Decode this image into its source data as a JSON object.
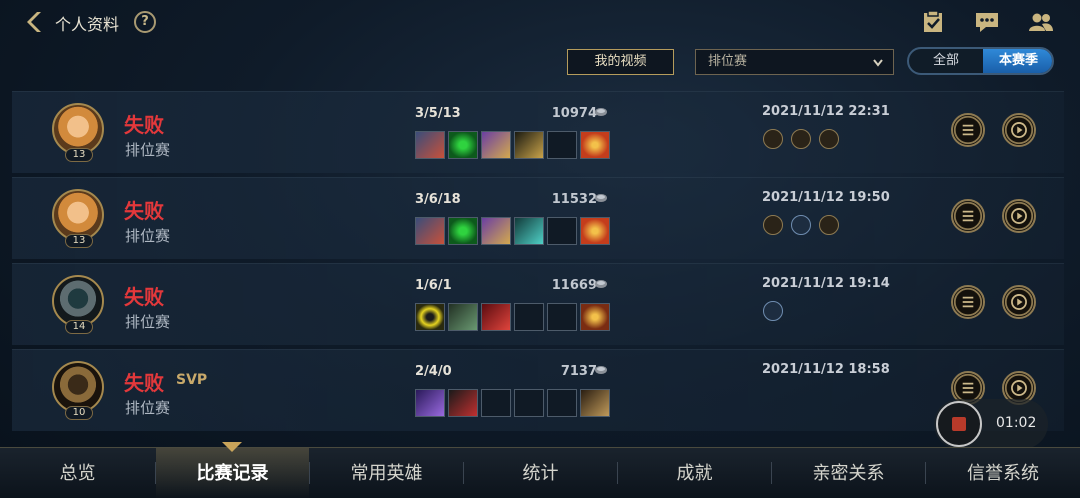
{
  "header": {
    "title": "个人资料",
    "help": "?"
  },
  "toolbar": {
    "video_button": "我的视频",
    "mode_select": "排位赛",
    "toggle_all": "全部",
    "toggle_season": "本赛季"
  },
  "matches": [
    {
      "level": "13",
      "result": "失败",
      "svp": "",
      "mode": "排位赛",
      "kda": "3/5/13",
      "gold": "10974",
      "time": "2021/11/12 22:31"
    },
    {
      "level": "13",
      "result": "失败",
      "svp": "",
      "mode": "排位赛",
      "kda": "3/6/18",
      "gold": "11532",
      "time": "2021/11/12 19:50"
    },
    {
      "level": "14",
      "result": "失败",
      "svp": "",
      "mode": "排位赛",
      "kda": "1/6/1",
      "gold": "11669",
      "time": "2021/11/12 19:14"
    },
    {
      "level": "10",
      "result": "失败",
      "svp": "SVP",
      "mode": "排位赛",
      "kda": "2/4/0",
      "gold": "7137",
      "time": "2021/11/12 18:58"
    }
  ],
  "tabs": [
    "总览",
    "比赛记录",
    "常用英雄",
    "统计",
    "成就",
    "亲密关系",
    "信誉系统"
  ],
  "recording": {
    "time": "01:02"
  },
  "colors": {
    "loss": "#e3383b",
    "accent_gold": "#b59c5c",
    "toggle_active": "#2f89d8"
  }
}
